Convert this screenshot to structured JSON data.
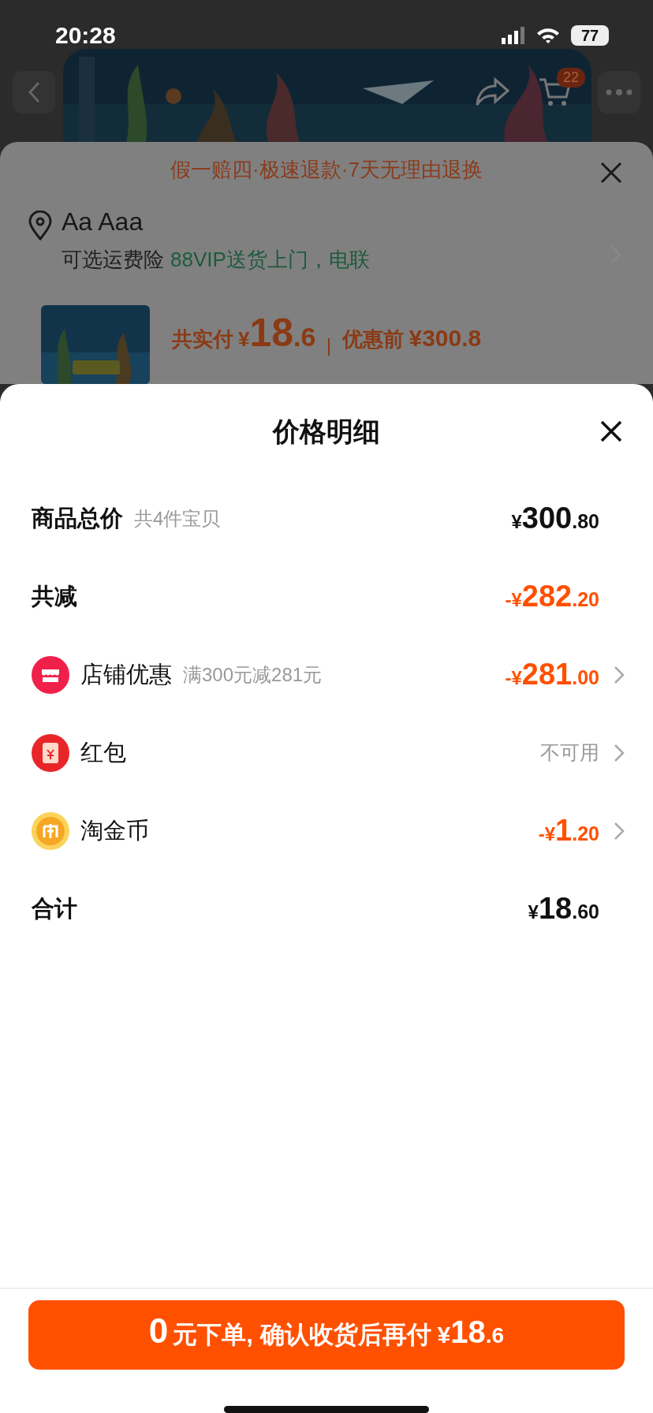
{
  "status_bar": {
    "time": "20:28",
    "battery": "77"
  },
  "nav": {
    "cart_badge": "22"
  },
  "background_panel": {
    "guarantee": "假一赔四·极速退款·7天无理由退换",
    "address": {
      "name": "Aa Aaa",
      "insurance": "可选运费险",
      "delivery": "88VIP送货上门，电联"
    },
    "product": {
      "paid_label": "共实付",
      "currency": "¥",
      "paid_int": "18",
      "paid_dec": ".6",
      "before_label": "优惠前",
      "before_amount": "¥300.8"
    }
  },
  "sheet": {
    "title": "价格明细",
    "rows": [
      {
        "kind": "total",
        "label": "商品总价",
        "note": "共4件宝贝",
        "amount": {
          "prefix": "¥",
          "int": "300",
          "dec": ".80"
        },
        "chevron": false
      },
      {
        "kind": "reduction",
        "label": "共减",
        "amount": {
          "prefix": "-¥",
          "int": "282",
          "dec": ".20"
        },
        "chevron": false
      },
      {
        "kind": "shop",
        "label": "店铺优惠",
        "note": "满300元减281元",
        "amount": {
          "prefix": "-¥",
          "int": "281",
          "dec": ".00"
        },
        "chevron": true
      },
      {
        "kind": "packet",
        "label": "红包",
        "status": "不可用",
        "chevron": true
      },
      {
        "kind": "coin",
        "label": "淘金币",
        "amount": {
          "prefix": "-¥",
          "int": "1",
          "dec": ".20"
        },
        "chevron": true
      },
      {
        "kind": "total",
        "label": "合计",
        "amount": {
          "prefix": "¥",
          "int": "18",
          "dec": ".60"
        },
        "chevron": false
      }
    ],
    "confirm_button": {
      "lead": "0",
      "text": "元下单, 确认收货后再付",
      "currency": "¥",
      "int": "18",
      "dec": ".6"
    }
  }
}
